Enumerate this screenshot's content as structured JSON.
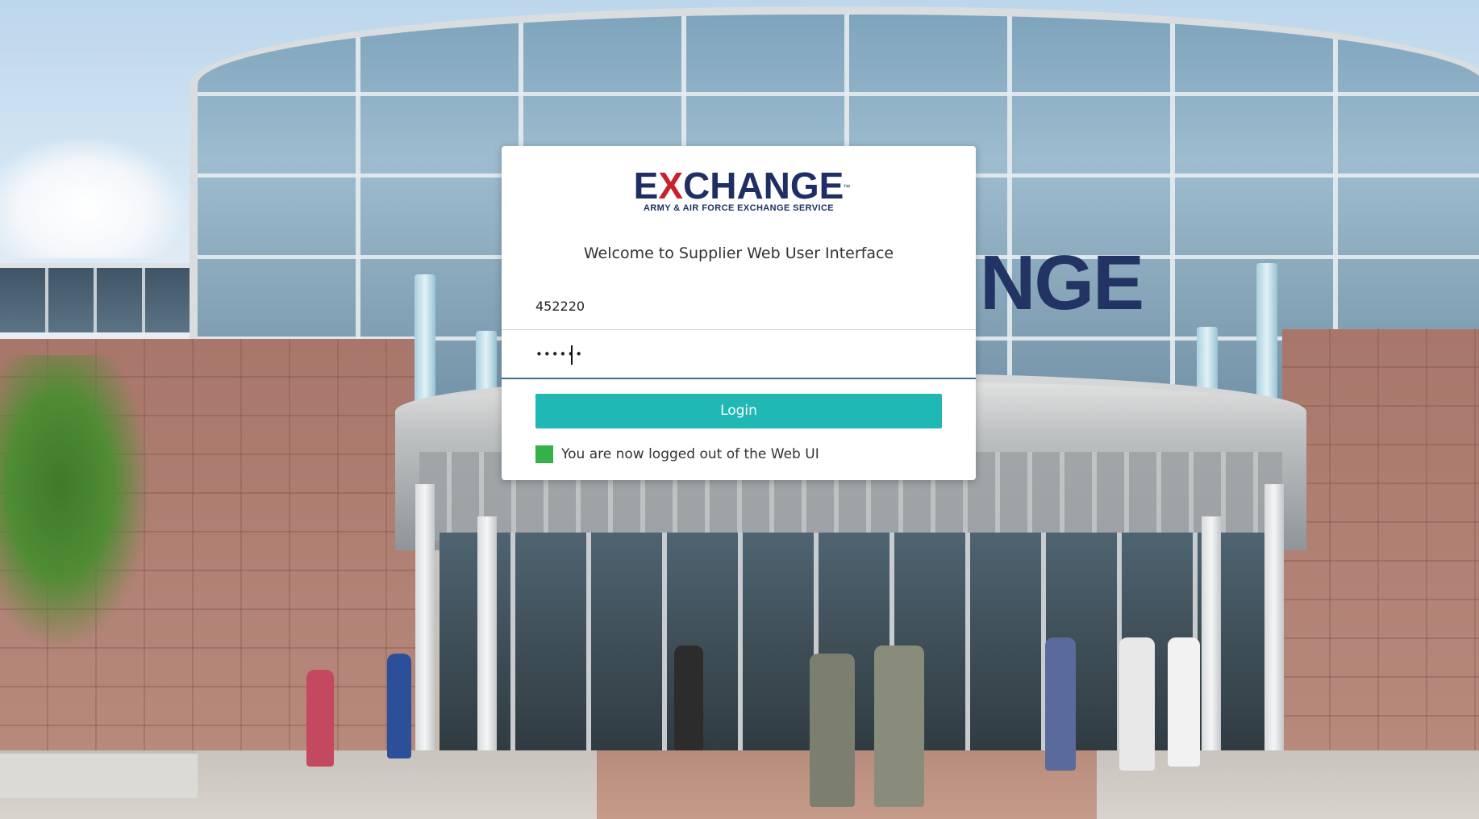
{
  "logo": {
    "word_before_x": "E",
    "word_x": "X",
    "word_after_x": "CHANGE",
    "trademark": "™",
    "subtitle": "ARMY & AIR FORCE EXCHANGE SERVICE"
  },
  "welcome_text": "Welcome to Supplier Web User Interface",
  "form": {
    "username_value": "452220",
    "password_value": "••••••",
    "login_label": "Login"
  },
  "status": {
    "message": "You are now logged out of the Web UI",
    "indicator_color": "#36b14a"
  },
  "background": {
    "building_sign": "NGE"
  },
  "colors": {
    "brand_navy": "#1f2f63",
    "brand_red": "#c8202e",
    "login_button": "#20b8b4",
    "field_focus_border": "#3d6f86"
  }
}
